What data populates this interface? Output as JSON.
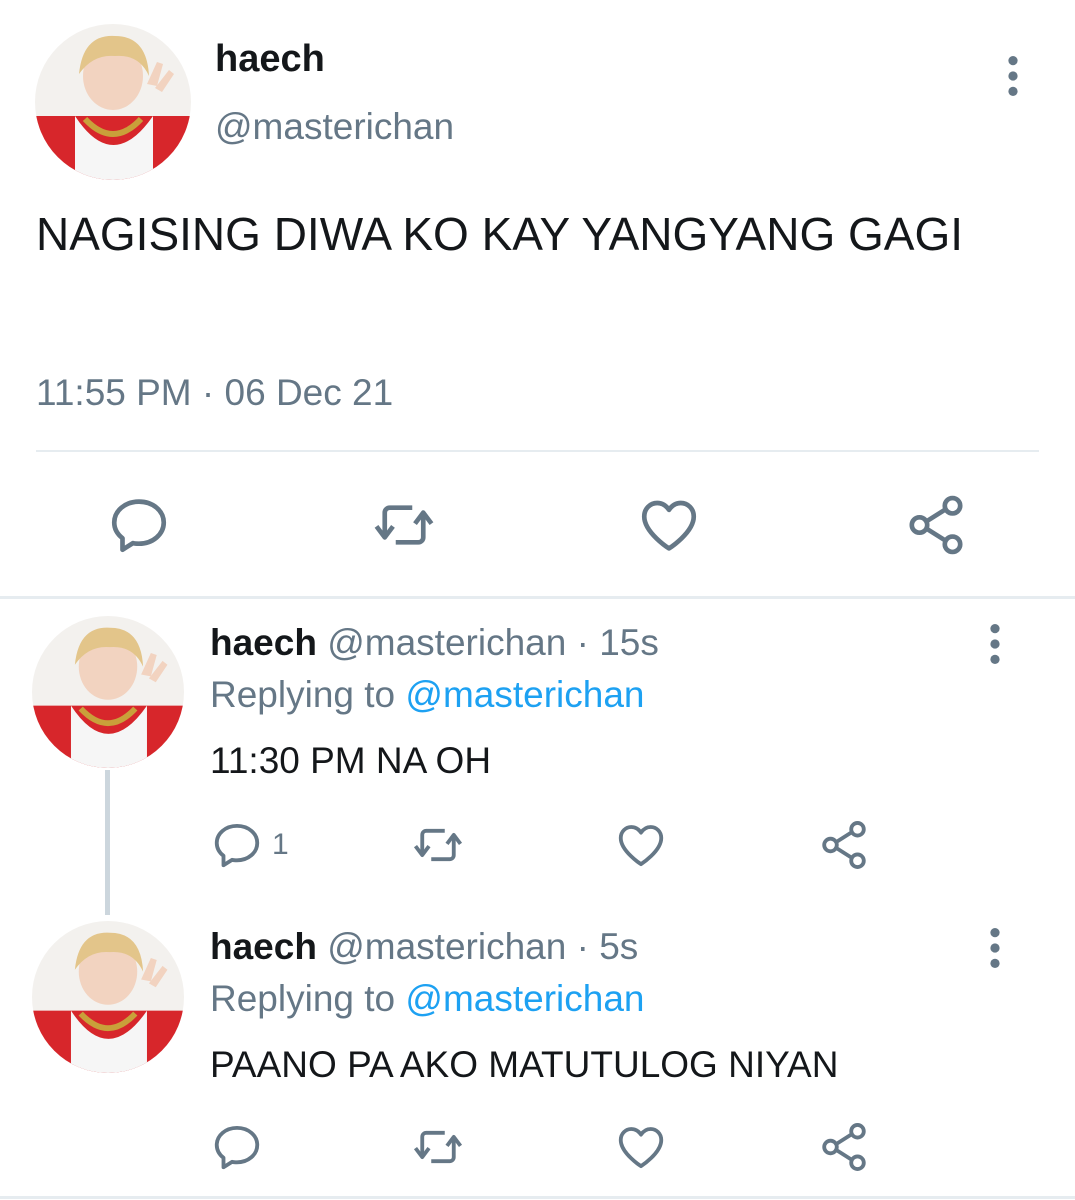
{
  "main_tweet": {
    "display_name": "haech",
    "handle": "@masterichan",
    "text": "NAGISING DIWA KO KAY YANGYANG GAGI",
    "timestamp": "11:55 PM · 06 Dec 21",
    "actions": [
      "reply-icon",
      "retweet-icon",
      "like-icon",
      "share-icon"
    ]
  },
  "replies": [
    {
      "display_name": "haech",
      "meta": "@masterichan · 15s",
      "replying_prefix": "Replying to ",
      "replying_to": "@masterichan",
      "text": "11:30 PM NA OH",
      "reply_count": "1"
    },
    {
      "display_name": "haech",
      "meta": "@masterichan · 5s",
      "replying_prefix": "Replying to ",
      "replying_to": "@masterichan",
      "text": "PAANO PA AKO MATUTULOG NIYAN",
      "reply_count": ""
    }
  ],
  "colors": {
    "text": "#14171a",
    "secondary": "#657786",
    "link": "#1da1f2",
    "divider": "#e6ecf0",
    "avatar_shirt": "#d7262b"
  }
}
